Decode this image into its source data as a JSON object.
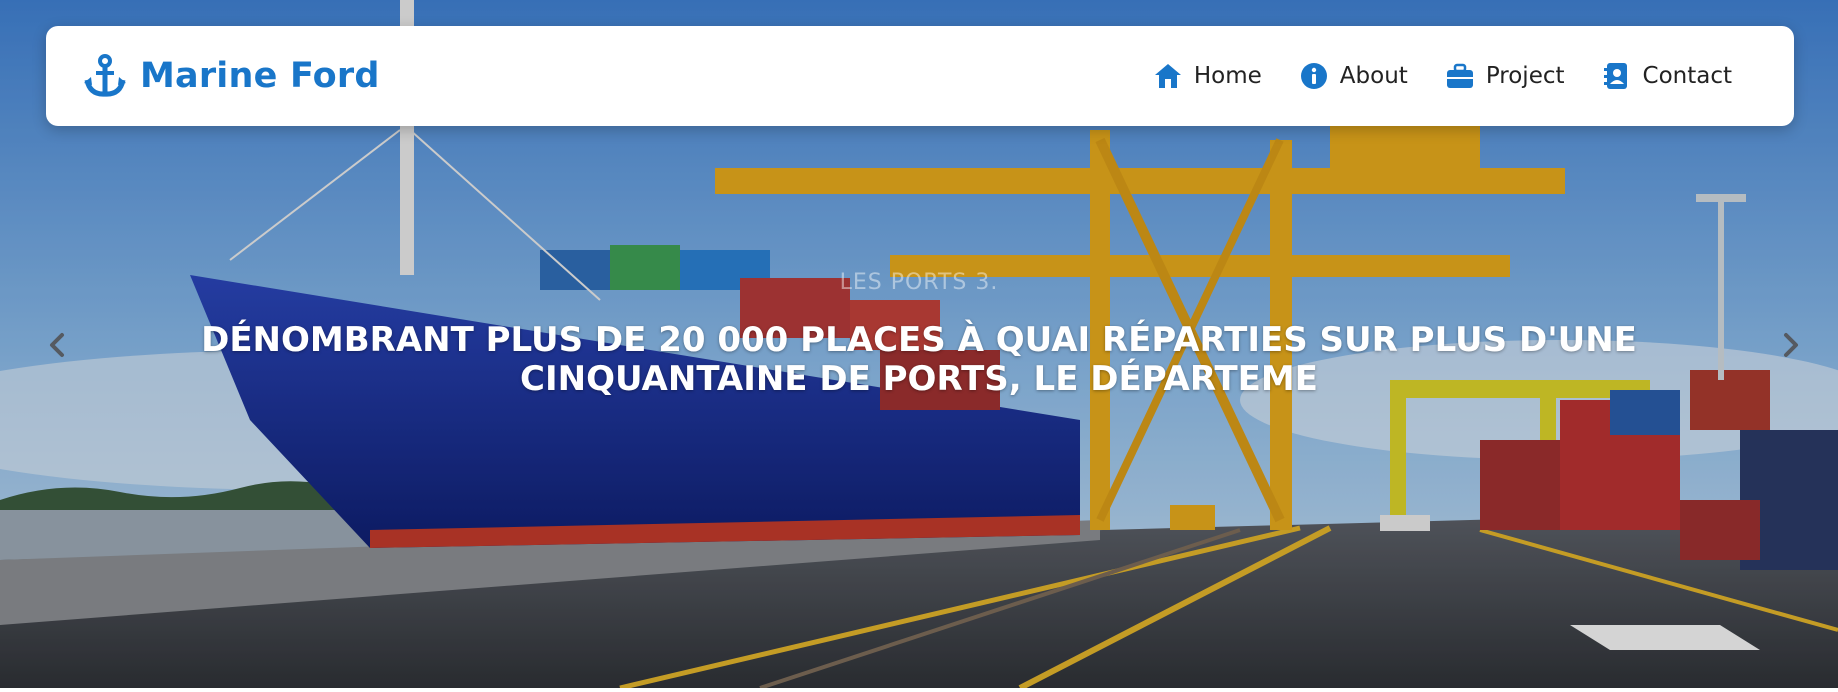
{
  "brand": {
    "name": "Marine Ford",
    "icon": "anchor-icon",
    "color": "#1976c9"
  },
  "nav": {
    "items": [
      {
        "label": "Home",
        "icon": "home-icon"
      },
      {
        "label": "About",
        "icon": "info-icon"
      },
      {
        "label": "Project",
        "icon": "briefcase-icon"
      },
      {
        "label": "Contact",
        "icon": "contact-card-icon"
      }
    ]
  },
  "slider": {
    "subtitle": "LES PORTS 3.",
    "title": "DÉNOMBRANT PLUS DE 20 000 PLACES À QUAI RÉPARTIES SUR PLUS D'UNE CINQUANTAINE DE PORTS, LE DÉPARTEME",
    "prev_icon": "chevron-left-icon",
    "next_icon": "chevron-right-icon",
    "background_image": "container port with cargo ship and yellow gantry cranes"
  }
}
